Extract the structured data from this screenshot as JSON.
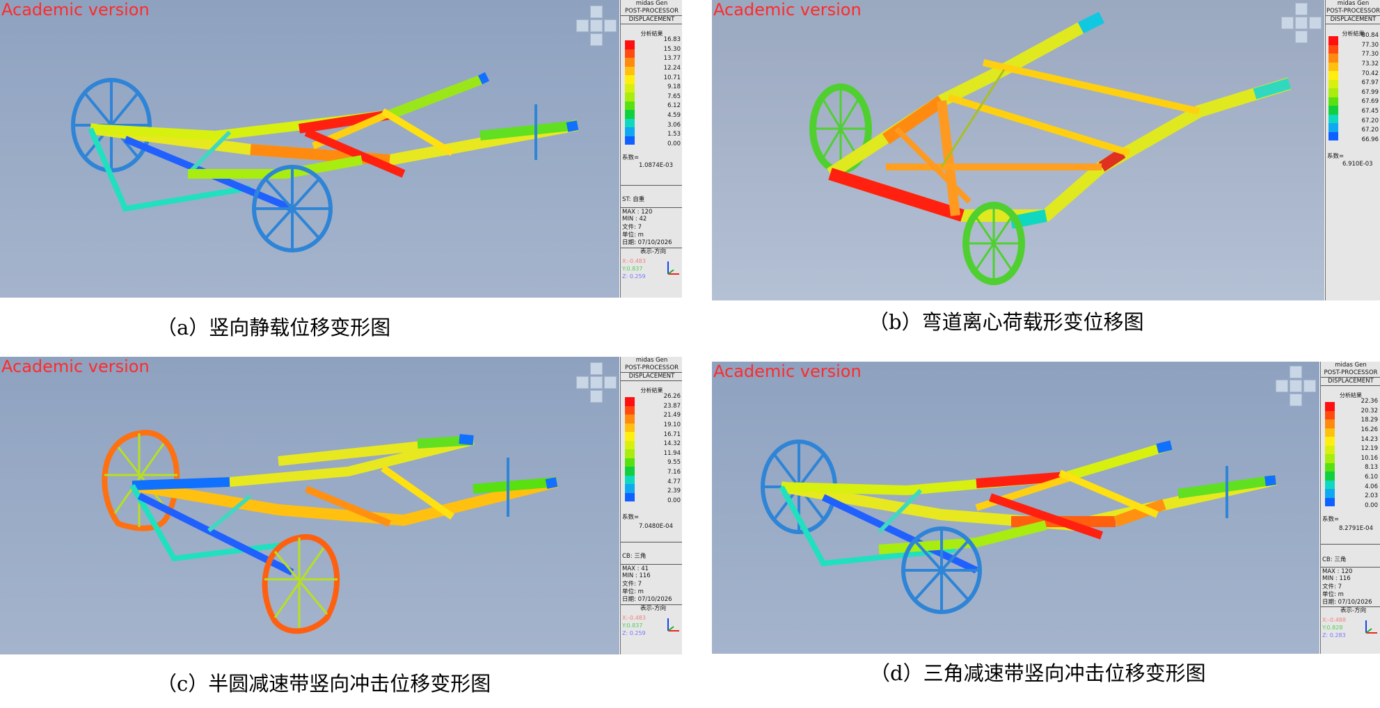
{
  "figures": [
    {
      "id": "a",
      "watermark": "Academic version",
      "program": "midas Gen",
      "module": "POST-PROCESSOR",
      "result_type": "DISPLACEMENT",
      "legend_title": "分析結果",
      "legend_values": [
        "16.83",
        "15.30",
        "13.77",
        "12.24",
        "10.71",
        "9.18",
        "7.65",
        "6.12",
        "4.59",
        "3.06",
        "1.53",
        "0.00"
      ],
      "factor_label": "系数=",
      "factor_value": "1.0874E-03",
      "load_case": "ST: 自重",
      "max": "MAX : 120",
      "min": "MIN : 42",
      "file": "文件: 7",
      "unit": "单位: m",
      "date": "日期: 07/10/2026",
      "view_dir": "表示-方向",
      "x_dir": "X:-0.483",
      "y_dir": "Y:0.837",
      "z_dir": "Z: 0.259",
      "caption": "（a）竖向静载位移变形图"
    },
    {
      "id": "b",
      "watermark": "Academic version",
      "program": "midas Gen",
      "module": "POST-PROCESSOR",
      "result_type": "DISPLACEMENT",
      "legend_title": "分析結果",
      "legend_values": [
        "80.84",
        "77.30",
        "77.30",
        "73.32",
        "70.42",
        "67.97",
        "67.99",
        "67.69",
        "67.45",
        "67.20",
        "67.20",
        "66.96"
      ],
      "factor_label": "系数=",
      "factor_value": "6.910E-03",
      "caption": "（b）弯道离心荷载形变位移图"
    },
    {
      "id": "c",
      "watermark": "Academic version",
      "program": "midas Gen",
      "module": "POST-PROCESSOR",
      "result_type": "DISPLACEMENT",
      "legend_title": "分析結果",
      "legend_values": [
        "26.26",
        "23.87",
        "21.49",
        "19.10",
        "16.71",
        "14.32",
        "11.94",
        "9.55",
        "7.16",
        "4.77",
        "2.39",
        "0.00"
      ],
      "factor_label": "系数=",
      "factor_value": "7.0480E-04",
      "load_case": "CB: 三角",
      "max": "MAX : 41",
      "min": "MIN : 116",
      "file": "文件: 7",
      "unit": "单位: m",
      "date": "日期: 07/10/2026",
      "view_dir": "表示-方向",
      "x_dir": "X:-0.483",
      "y_dir": "Y:0.837",
      "z_dir": "Z: 0.259",
      "caption": "（c）半圆减速带竖向冲击位移变形图"
    },
    {
      "id": "d",
      "watermark": "Academic version",
      "program": "midas Gen",
      "module": "POST-PROCESSOR",
      "result_type": "DISPLACEMENT",
      "legend_title": "分析結果",
      "legend_values": [
        "22.36",
        "20.32",
        "18.29",
        "16.26",
        "14.23",
        "12.19",
        "10.16",
        "8.13",
        "6.10",
        "4.06",
        "2.03",
        "0.00"
      ],
      "factor_label": "系数=",
      "factor_value": "8.2791E-04",
      "load_case": "CB: 三角",
      "max": "MAX : 120",
      "min": "MIN : 116",
      "file": "文件: 7",
      "unit": "单位: m",
      "date": "日期: 07/10/2026",
      "view_dir": "表示-方向",
      "x_dir": "X:-0.488",
      "y_dir": "Y:0.828",
      "z_dir": "Z: 0.283",
      "caption": "（d）三角减速带竖向冲击位移变形图"
    }
  ],
  "colors": {
    "legend_scale": [
      "#ff1010",
      "#ff4a10",
      "#ff8a10",
      "#ffc010",
      "#ffee10",
      "#d8f010",
      "#a8ec10",
      "#58e010",
      "#10d040",
      "#10d8c0",
      "#10a8f0",
      "#1060ff"
    ],
    "viewport_top": "#8ea2c0",
    "viewport_bottom": "#a4b3cb",
    "panel_bg": "#e6e6e6",
    "watermark": "#ff2a2a"
  }
}
